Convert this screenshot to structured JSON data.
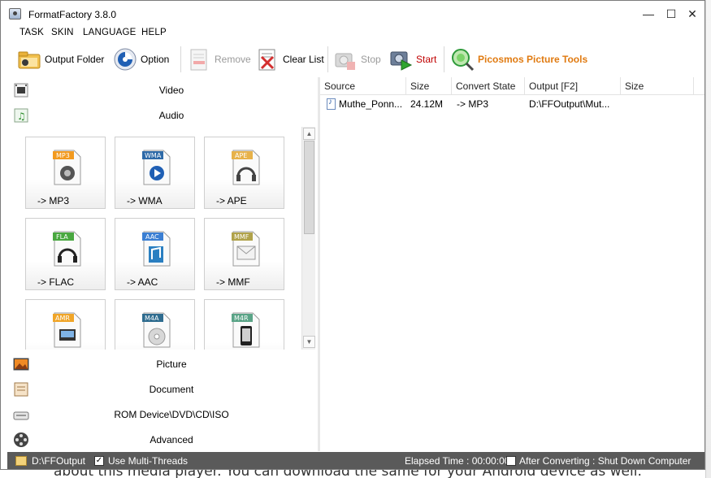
{
  "window": {
    "title": "FormatFactory 3.8.0",
    "minimize": "—",
    "maximize": "☐",
    "close": "✕"
  },
  "menu": [
    "TASK",
    "SKIN",
    "LANGUAGE",
    "HELP"
  ],
  "toolbar": {
    "output_folder": "Output Folder",
    "option": "Option",
    "remove": "Remove",
    "clear_list": "Clear List",
    "stop": "Stop",
    "start": "Start",
    "picosmos": "Picosmos Picture Tools"
  },
  "categories": {
    "video": "Video",
    "audio": "Audio",
    "picture": "Picture",
    "document": "Document",
    "rom": "ROM Device\\DVD\\CD\\ISO",
    "advanced": "Advanced"
  },
  "audio_formats": [
    {
      "badge": "MP3",
      "label": "-> MP3",
      "color": "#f29a1f"
    },
    {
      "badge": "WMA",
      "label": "-> WMA",
      "color": "#2e6aa8"
    },
    {
      "badge": "APE",
      "label": "-> APE",
      "color": "#e7b24a"
    },
    {
      "badge": "FLA",
      "label": "-> FLAC",
      "color": "#49a840"
    },
    {
      "badge": "AAC",
      "label": "-> AAC",
      "color": "#3b7fd3"
    },
    {
      "badge": "MMF",
      "label": "-> MMF",
      "color": "#b0a24a"
    },
    {
      "badge": "AMR",
      "label": "",
      "color": "#f0a528"
    },
    {
      "badge": "M4A",
      "label": "",
      "color": "#2f6c8f"
    },
    {
      "badge": "M4R",
      "label": "",
      "color": "#5aa487"
    }
  ],
  "list": {
    "columns": [
      "Source",
      "Size",
      "Convert State",
      "Output [F2]",
      "Size"
    ],
    "rows": [
      {
        "source": "Muthe_Ponn...",
        "size": "24.12M",
        "state": "-> MP3",
        "output": "D:\\FFOutput\\Mut...",
        "out_size": ""
      }
    ]
  },
  "status": {
    "output_path": "D:\\FFOutput",
    "multi_threads_label": "Use Multi-Threads",
    "multi_threads_checked": true,
    "elapsed": "Elapsed Time : 00:00:00",
    "after_converting": "After Converting : Shut Down Computer",
    "after_converting_checked": false
  },
  "background_page_text": "about this media player. You can download the same for your Android device as well."
}
